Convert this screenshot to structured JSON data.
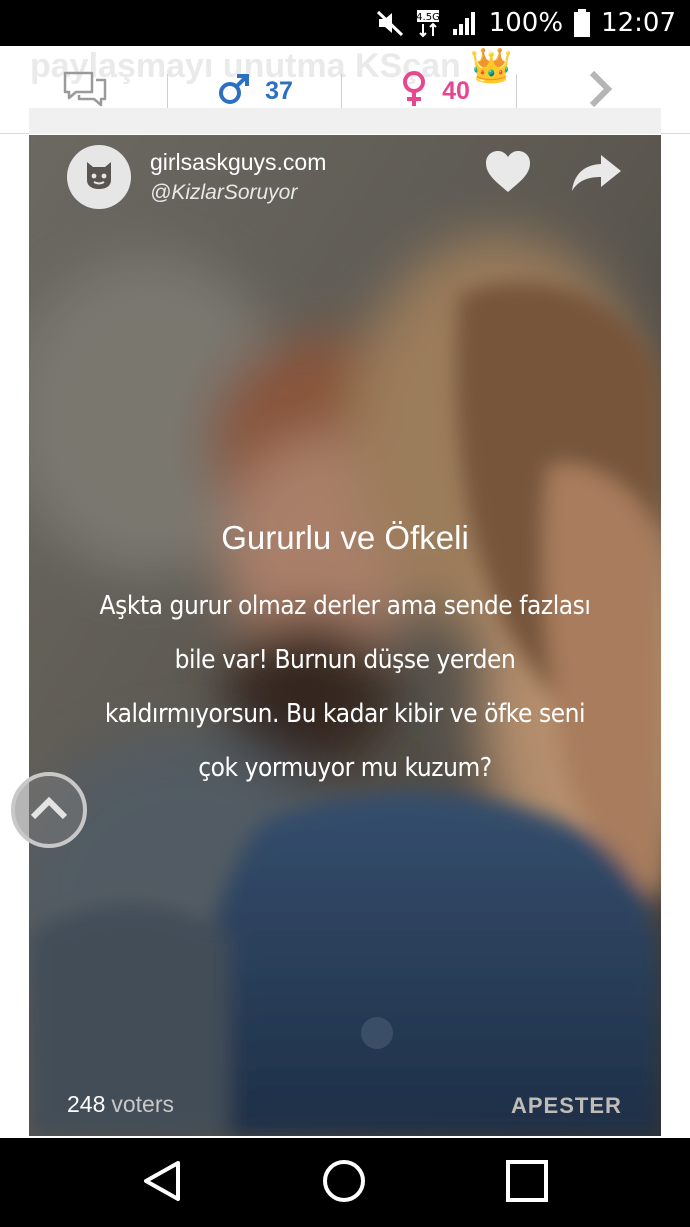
{
  "status_bar": {
    "battery_percent": "100%",
    "time": "12:07",
    "network_badge": "4.5G",
    "icons": [
      "mute-icon",
      "network-4-5g-icon",
      "signal-icon",
      "battery-icon"
    ]
  },
  "action_bar": {
    "faded_text": "paylaşmayı unutma KSçan 👑",
    "icons": [
      "comments-icon",
      "male-icon",
      "female-icon",
      "chevron-right-icon"
    ],
    "male_count": "37",
    "female_count": "40",
    "male_color": "#2d6fc2",
    "female_color": "#e5488f"
  },
  "card": {
    "site_name": "girlsaskguys.com",
    "handle": "@KizlarSoruyor",
    "result_title": "Gururlu ve Öfkeli",
    "result_description": "Aşkta gurur olmaz derler ama sende fazlası bile var! Burnun düşse yerden kaldırmıyorsun. Bu kadar kibir ve öfke seni çok yormuyor mu kuzum?",
    "voters_count": "248",
    "voters_label": "voters",
    "brand": "APESTER",
    "icons": [
      "site-logo-icon",
      "heart-icon",
      "share-icon",
      "chevron-up-icon"
    ]
  },
  "nav_bar": {
    "icons": [
      "back-triangle-icon",
      "home-circle-icon",
      "recents-square-icon"
    ]
  }
}
